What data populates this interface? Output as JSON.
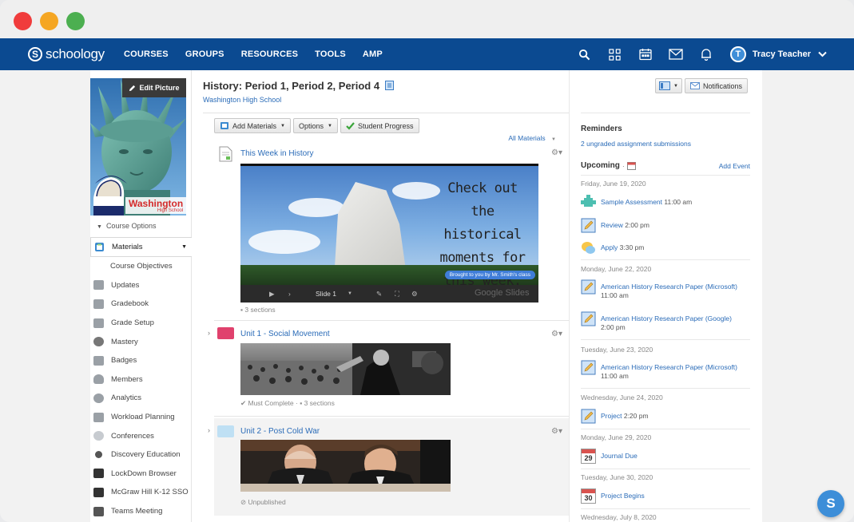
{
  "window": {
    "close": "red",
    "minimize": "yellow",
    "zoom": "green"
  },
  "nav": {
    "logo_text": "schoology",
    "links": [
      "COURSES",
      "GROUPS",
      "RESOURCES",
      "TOOLS",
      "AMP"
    ],
    "user_initial": "T",
    "user_name": "Tracy Teacher",
    "icons": [
      "search-icon",
      "apps-grid-icon",
      "calendar-icon",
      "mail-icon",
      "bell-icon",
      "chevron-down-icon"
    ]
  },
  "profile": {
    "edit_label": "Edit Picture",
    "label_line1": "Washington",
    "label_line2": "High School",
    "course_options": "Course Options"
  },
  "menu": [
    {
      "label": "Materials",
      "icon": "materials-icon"
    },
    {
      "label": "Course Objectives",
      "icon": ""
    },
    {
      "label": "Updates",
      "icon": "updates-icon"
    },
    {
      "label": "Gradebook",
      "icon": "gradebook-icon"
    },
    {
      "label": "Grade Setup",
      "icon": "grade-setup-icon"
    },
    {
      "label": "Mastery",
      "icon": "mastery-icon"
    },
    {
      "label": "Badges",
      "icon": "badges-icon"
    },
    {
      "label": "Members",
      "icon": "members-icon"
    },
    {
      "label": "Analytics",
      "icon": "analytics-icon"
    },
    {
      "label": "Workload Planning",
      "icon": "workload-icon"
    },
    {
      "label": "Conferences",
      "icon": "conferences-icon"
    },
    {
      "label": "Discovery Education",
      "icon": "discovery-icon"
    },
    {
      "label": "LockDown Browser",
      "icon": "lockdown-icon"
    },
    {
      "label": "McGraw Hill K-12 SSO",
      "icon": "mcgraw-icon"
    },
    {
      "label": "Teams Meeting",
      "icon": "teams-icon"
    }
  ],
  "course": {
    "title": "History: Period 1, Period 2, Period 4",
    "school": "Washington High School",
    "toolbar": {
      "add_materials": "Add Materials",
      "options": "Options",
      "student_progress": "Student Progress"
    },
    "all_materials": "All Materials",
    "notifications": "Notifications"
  },
  "materials": [
    {
      "title": "This Week in History",
      "meta": "3 sections",
      "slide_text": "Check out the historical moments for this week.",
      "slide_credit": "Brought to you by Mr. Smith's class",
      "slide_label": "Slide 1",
      "slide_brand": "Google Slides"
    },
    {
      "title": "Unit 1 - Social Movement",
      "must_complete": "Must Complete",
      "meta": "3 sections"
    },
    {
      "title": "Unit 2 - Post Cold War",
      "status": "Unpublished"
    }
  ],
  "reminders": {
    "heading": "Reminders",
    "link": "2 ungraded assignment submissions"
  },
  "upcoming": {
    "heading": "Upcoming",
    "add_event": "Add Event",
    "groups": [
      {
        "date": "Friday, June 19, 2020",
        "items": [
          {
            "title": "Sample Assessment",
            "time": "11:00 am",
            "icon": "assessment-icon"
          },
          {
            "title": "Review",
            "time": "2:00 pm",
            "icon": "assignment-icon"
          },
          {
            "title": "Apply",
            "time": "3:30 pm",
            "icon": "discussion-icon"
          }
        ]
      },
      {
        "date": "Monday, June 22, 2020",
        "items": [
          {
            "title": "American History Research Paper (Microsoft)",
            "time": "11:00 am",
            "icon": "assignment-icon"
          },
          {
            "title": "American History Research Paper (Google)",
            "time": "2:00 pm",
            "icon": "assignment-icon"
          }
        ]
      },
      {
        "date": "Tuesday, June 23, 2020",
        "items": [
          {
            "title": "American History Research Paper (Microsoft)",
            "time": "11:00 am",
            "icon": "assignment-icon"
          }
        ]
      },
      {
        "date": "Wednesday, June 24, 2020",
        "items": [
          {
            "title": "Project",
            "time": "2:20 pm",
            "icon": "assignment-icon"
          }
        ]
      },
      {
        "date": "Monday, June 29, 2020",
        "items": [
          {
            "title": "Journal Due",
            "time": "",
            "icon": "calendar-29-icon",
            "day": "29"
          }
        ]
      },
      {
        "date": "Tuesday, June 30, 2020",
        "items": [
          {
            "title": "Project Begins",
            "time": "",
            "icon": "calendar-30-icon",
            "day": "30"
          }
        ]
      },
      {
        "date": "Wednesday, July 8, 2020",
        "items": []
      }
    ]
  },
  "fab": "S",
  "colors": {
    "nav": "#0b4a91",
    "link": "#2b6cb8",
    "accent": "#3d8ed8"
  }
}
